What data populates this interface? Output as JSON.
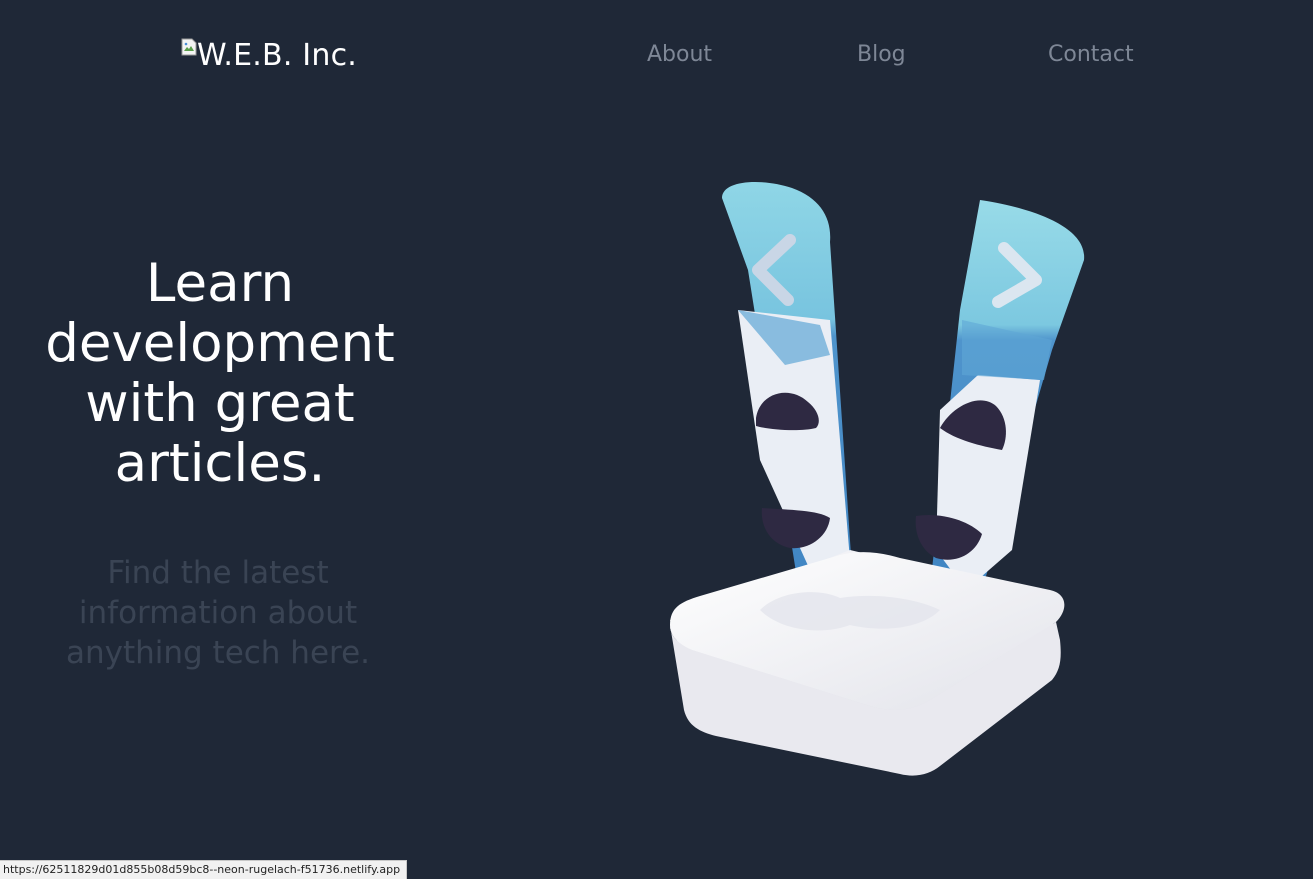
{
  "header": {
    "logo_alt": "W.E.B. Inc.",
    "nav": [
      {
        "label": "About"
      },
      {
        "label": "Blog"
      },
      {
        "label": "Contact"
      }
    ]
  },
  "hero": {
    "title": "Learn development with great articles.",
    "subtitle": "Find the latest information about anything tech here."
  },
  "illustration": {
    "icon": "skis-in-snow-illustration",
    "colors": {
      "ski_light": "#8fd3e0",
      "ski_dark": "#4a90c8",
      "ski_white": "#e9eef5",
      "binding": "#2f2a44",
      "snow": "#eeeef2"
    }
  },
  "status_bar": {
    "url": "https://62511829d01d855b08d59bc8--neon-rugelach-f51736.netlify.app"
  },
  "colors": {
    "background": "#1f2837",
    "nav_text": "#7e8796",
    "title_text": "#ffffff",
    "subtitle_text": "#3a4454"
  }
}
